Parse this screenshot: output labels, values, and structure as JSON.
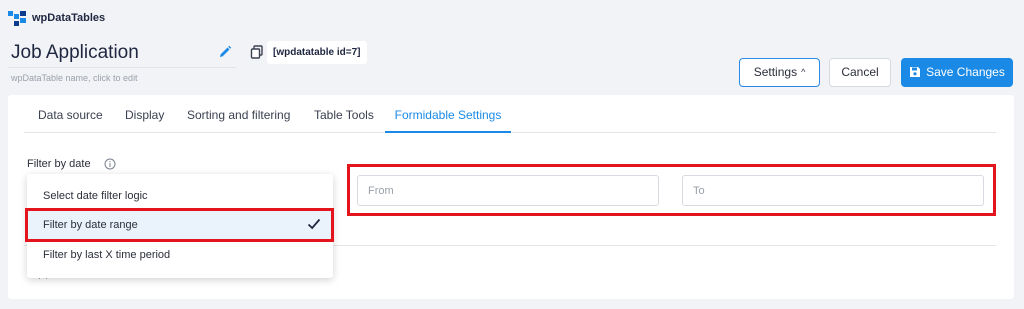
{
  "brand": {
    "name": "wpDataTables",
    "logo_icon": "wpdatatables-logo"
  },
  "header": {
    "table_name": "Job Application",
    "name_hint": "wpDataTable name, click to edit",
    "shortcode": "[wpdatatable id=7]",
    "edit_icon": "pencil-icon",
    "copy_icon": "copy-icon"
  },
  "toolbar": {
    "settings_label": "Settings",
    "settings_chevron": "^",
    "cancel_label": "Cancel",
    "save_label": "Save Changes",
    "accent": "#1a8ae6"
  },
  "tabs": [
    {
      "label": "Data source",
      "active": false
    },
    {
      "label": "Display",
      "active": false
    },
    {
      "label": "Sorting and filtering",
      "active": false
    },
    {
      "label": "Table Tools",
      "active": false
    },
    {
      "label": "Formidable Settings",
      "active": true
    }
  ],
  "filter": {
    "label": "Filter by date",
    "options": [
      {
        "label": "Select date filter logic"
      },
      {
        "label": "Filter by date range",
        "selected": true
      },
      {
        "label": "Filter by last X time period"
      }
    ],
    "from_placeholder": "From",
    "to_placeholder": "To"
  },
  "highlight_color": "#e3141b"
}
